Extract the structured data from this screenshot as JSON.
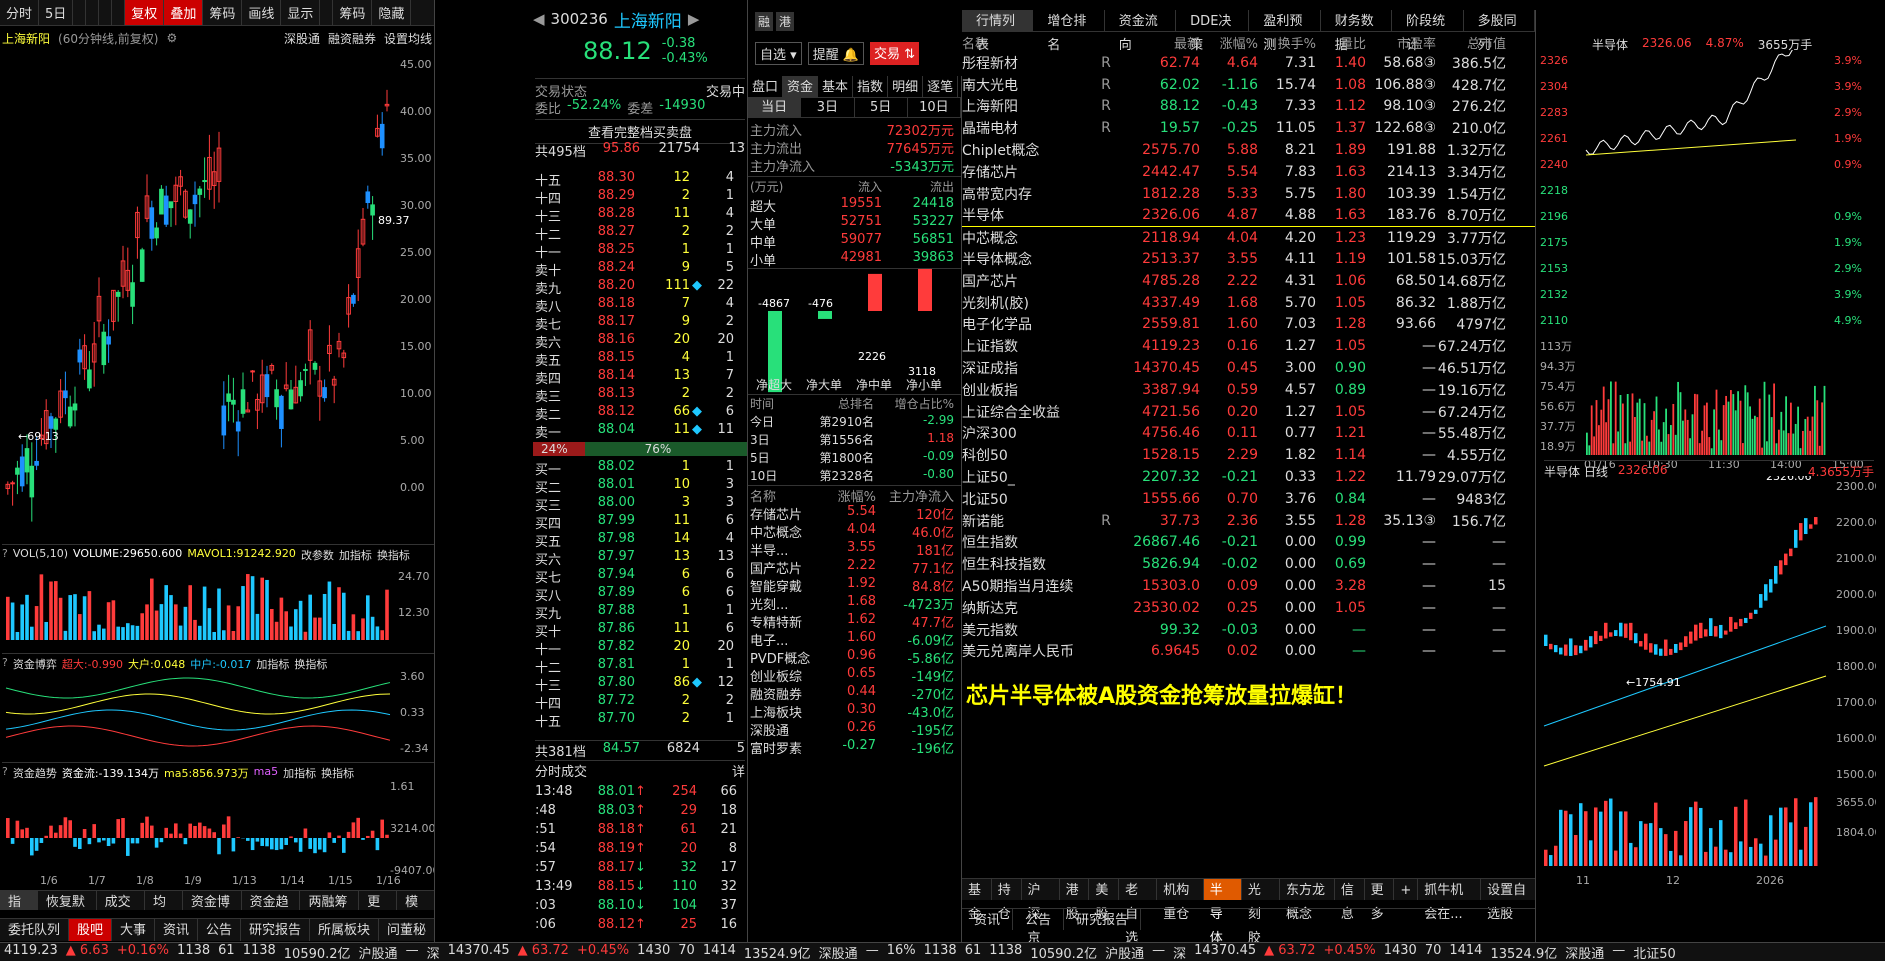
{
  "toolbar": {
    "items": [
      "分时",
      "5日",
      "",
      "",
      "",
      "",
      "复权",
      "叠加",
      "筹码",
      "画线",
      "显示",
      "",
      "筹码",
      "隐藏"
    ]
  },
  "kchart": {
    "title": "上海新阳",
    "subtitle": "(60分钟线,前复权)",
    "links": [
      "深股通",
      "融资融券",
      "设置均线"
    ],
    "yaxis": [
      "45.00",
      "40.00",
      "35.00",
      "30.00",
      "25.00",
      "20.00",
      "15.00",
      "10.00",
      "5.00",
      "0.00"
    ],
    "hi_label": "89.37",
    "lo_label": "69.13",
    "xaxis": [
      "1/6",
      "1/7",
      "1/8",
      "1/9",
      "1/13",
      "1/14",
      "1/15",
      "1/16"
    ],
    "vol": {
      "title": "VOL(5,10)",
      "value": "VOLUME:29650.600",
      "ma": "MAVOL1:91242.920",
      "y": [
        "24.70",
        "12.30"
      ]
    },
    "game": {
      "title": "资金博弈",
      "a": "超大:-0.990",
      "b": "大户:0.048",
      "c": "中户:-0.017",
      "y": [
        "3.60",
        "0.33",
        "-2.34"
      ]
    },
    "trend": {
      "title": "资金趋势",
      "a": "资金流:-139.134万",
      "b": "ma5:856.973万",
      "c": "ma5",
      "y": [
        "1.61",
        "3214.00",
        "-9407.00"
      ]
    },
    "sub_links": [
      "改参数",
      "加指标",
      "换指标"
    ],
    "bottom_tabs": [
      "指标",
      "恢复默认",
      "成交量",
      "均线",
      "资金博弈",
      "资金趋势",
      "两融筹码",
      "更多",
      "模板"
    ]
  },
  "quote": {
    "code": "300236",
    "name": "上海新阳",
    "tags": [
      "融",
      "港"
    ],
    "price": "88.12",
    "chg": "-0.38",
    "pct": "-0.43%",
    "btn1": "自选",
    "btn2": "提醒",
    "btn3": "交易",
    "status_label": "交易状态",
    "status": "交易中",
    "wb_label": "委比",
    "wb": "-52.24%",
    "wc_label": "委差",
    "wc": "-14930",
    "full_label": "查看完整档买卖盘",
    "sell_total": [
      "共495档",
      "95.86",
      "21754",
      "13"
    ],
    "sells": [
      [
        "十五",
        "88.30",
        "12",
        "4",
        ""
      ],
      [
        "十四",
        "88.29",
        "2",
        "1",
        ""
      ],
      [
        "十三",
        "88.28",
        "11",
        "4",
        ""
      ],
      [
        "十二",
        "88.27",
        "2",
        "2",
        ""
      ],
      [
        "十一",
        "88.25",
        "1",
        "1",
        ""
      ],
      [
        "卖十",
        "88.24",
        "9",
        "5",
        ""
      ],
      [
        "卖九",
        "88.20",
        "111",
        "22",
        "◆"
      ],
      [
        "卖八",
        "88.18",
        "7",
        "4",
        ""
      ],
      [
        "卖七",
        "88.17",
        "9",
        "2",
        ""
      ],
      [
        "卖六",
        "88.16",
        "20",
        "20",
        ""
      ],
      [
        "卖五",
        "88.15",
        "4",
        "1",
        ""
      ],
      [
        "卖四",
        "88.14",
        "13",
        "7",
        ""
      ],
      [
        "卖三",
        "88.13",
        "2",
        "2",
        ""
      ],
      [
        "卖二",
        "88.12",
        "66",
        "6",
        "◆"
      ],
      [
        "卖一",
        "88.04",
        "11",
        "11",
        "◆"
      ]
    ],
    "ratio": [
      "24%",
      "76%"
    ],
    "buys": [
      [
        "买一",
        "88.02",
        "1",
        "1",
        ""
      ],
      [
        "买二",
        "88.01",
        "10",
        "3",
        ""
      ],
      [
        "买三",
        "88.00",
        "3",
        "3",
        ""
      ],
      [
        "买四",
        "87.99",
        "11",
        "6",
        ""
      ],
      [
        "买五",
        "87.98",
        "14",
        "4",
        ""
      ],
      [
        "买六",
        "87.97",
        "13",
        "13",
        ""
      ],
      [
        "买七",
        "87.94",
        "6",
        "6",
        ""
      ],
      [
        "买八",
        "87.89",
        "6",
        "6",
        ""
      ],
      [
        "买九",
        "87.88",
        "1",
        "1",
        ""
      ],
      [
        "买十",
        "87.86",
        "11",
        "6",
        ""
      ],
      [
        "十一",
        "87.82",
        "20",
        "20",
        ""
      ],
      [
        "十二",
        "87.81",
        "1",
        "1",
        ""
      ],
      [
        "十三",
        "87.80",
        "86",
        "12",
        "◆"
      ],
      [
        "十四",
        "87.72",
        "2",
        "2",
        ""
      ],
      [
        "十五",
        "87.70",
        "2",
        "1",
        ""
      ]
    ],
    "buy_total": [
      "共381档",
      "84.57",
      "6824",
      "5"
    ],
    "ticks_title": "分时成交",
    "ticks_btn": "详",
    "ticks": [
      [
        "13:48",
        "88.01",
        "↑",
        "254",
        "66"
      ],
      [
        ":48",
        "88.03",
        "↑",
        "29",
        "18"
      ],
      [
        ":51",
        "88.18",
        "↑",
        "61",
        "21"
      ],
      [
        ":54",
        "88.19",
        "↑",
        "20",
        "8"
      ],
      [
        ":57",
        "88.17",
        "↓",
        "32",
        "17"
      ],
      [
        "13:49",
        "88.15",
        "↓",
        "110",
        "32"
      ],
      [
        ":03",
        "88.10",
        "↓",
        "104",
        "37"
      ],
      [
        ":06",
        "88.12",
        "↑",
        "25",
        "16"
      ]
    ]
  },
  "fund": {
    "tabs": [
      "盘口",
      "资金",
      "基本",
      "指数",
      "明细",
      "逐笔"
    ],
    "subtabs": [
      "当日",
      "3日",
      "5日",
      "10日"
    ],
    "main": [
      [
        "主力流入",
        "72302万元"
      ],
      [
        "主力流出",
        "77645万元"
      ],
      [
        "主力净流入",
        "-5343万元"
      ]
    ],
    "unit": "(万元)",
    "col_in": "流入",
    "col_out": "流出",
    "rows": [
      [
        "超大",
        "19551",
        "24418"
      ],
      [
        "大单",
        "52751",
        "53227"
      ],
      [
        "中单",
        "59077",
        "56851"
      ],
      [
        "小单",
        "42981",
        "39863"
      ]
    ],
    "bars": [
      {
        "label": "净超大",
        "v": -4867
      },
      {
        "label": "净大单",
        "v": -476
      },
      {
        "label": "净中单",
        "v": 2226
      },
      {
        "label": "净小单",
        "v": 3118
      }
    ],
    "rank_head": [
      "时间",
      "总排名",
      "增仓占比%"
    ],
    "ranks": [
      [
        "今日",
        "第2910名",
        "-2.99"
      ],
      [
        "3日",
        "第1556名",
        "1.18"
      ],
      [
        "5日",
        "第1800名",
        "-0.09"
      ],
      [
        "10日",
        "第2328名",
        "-0.80"
      ]
    ],
    "sec_head": [
      "名称",
      "涨幅%",
      "主力净流入"
    ],
    "sectors": [
      [
        "存储芯片",
        "5.54",
        "120亿"
      ],
      [
        "中芯概念",
        "4.04",
        "46.0亿"
      ],
      [
        "半导...",
        "3.55",
        "181亿"
      ],
      [
        "国产芯片",
        "2.22",
        "77.1亿"
      ],
      [
        "智能穿戴",
        "1.92",
        "84.8亿"
      ],
      [
        "光刻...",
        "1.68",
        "-4723万"
      ],
      [
        "专精特新",
        "1.62",
        "47.7亿"
      ],
      [
        "电子...",
        "1.60",
        "-6.09亿"
      ],
      [
        "PVDF概念",
        "0.96",
        "-5.86亿"
      ],
      [
        "创业板综",
        "0.65",
        "-149亿"
      ],
      [
        "融资融券",
        "0.44",
        "-270亿"
      ],
      [
        "上海板块",
        "0.30",
        "-43.0亿"
      ],
      [
        "深股通",
        "0.26",
        "-195亿"
      ],
      [
        "富时罗素",
        "-0.27",
        "-196亿"
      ]
    ]
  },
  "list": {
    "tabs": [
      "行情列表",
      "增仓排名",
      "资金流向",
      "DDE决策",
      "盈利预测",
      "财务数据",
      "阶段统计",
      "多股同列"
    ],
    "head": [
      "名称",
      "",
      "最新",
      "涨幅%",
      "换手%",
      "量比",
      "市盈率",
      "总市值"
    ],
    "rows": [
      [
        "彤程新材",
        "R",
        "62.74",
        "4.64",
        "7.31",
        "1.40",
        "58.68③",
        "386.5亿"
      ],
      [
        "南大光电",
        "R",
        "62.02",
        "-1.16",
        "15.74",
        "1.08",
        "106.88③",
        "428.7亿"
      ],
      [
        "上海新阳",
        "R",
        "88.12",
        "-0.43",
        "7.33",
        "1.12",
        "98.10③",
        "276.2亿"
      ],
      [
        "晶瑞电材",
        "R",
        "19.57",
        "-0.25",
        "11.05",
        "1.37",
        "122.68③",
        "210.0亿"
      ],
      [
        "Chiplet概念",
        "",
        "2575.70",
        "5.88",
        "8.21",
        "1.89",
        "191.88",
        "1.32万亿"
      ],
      [
        "存储芯片",
        "",
        "2442.47",
        "5.54",
        "7.83",
        "1.63",
        "214.13",
        "3.34万亿"
      ],
      [
        "高带宽内存",
        "",
        "1812.28",
        "5.33",
        "5.75",
        "1.80",
        "103.39",
        "1.54万亿"
      ],
      [
        "半导体",
        "",
        "2326.06",
        "4.87",
        "4.88",
        "1.63",
        "183.76",
        "8.70万亿"
      ],
      [
        "中芯概念",
        "",
        "2118.94",
        "4.04",
        "4.20",
        "1.23",
        "119.29",
        "3.77万亿"
      ],
      [
        "半导体概念",
        "",
        "2513.37",
        "3.55",
        "4.11",
        "1.19",
        "101.58",
        "15.03万亿"
      ],
      [
        "国产芯片",
        "",
        "4785.28",
        "2.22",
        "4.31",
        "1.06",
        "68.50",
        "14.68万亿"
      ],
      [
        "光刻机(胶)",
        "",
        "4337.49",
        "1.68",
        "5.70",
        "1.05",
        "86.32",
        "1.88万亿"
      ],
      [
        "电子化学品",
        "",
        "2559.81",
        "1.60",
        "7.03",
        "1.28",
        "93.66",
        "4797亿"
      ],
      [
        "上证指数",
        "",
        "4119.23",
        "0.16",
        "1.27",
        "1.05",
        "—",
        "67.24万亿"
      ],
      [
        "深证成指",
        "",
        "14370.45",
        "0.45",
        "3.00",
        "0.90",
        "—",
        "46.51万亿"
      ],
      [
        "创业板指",
        "",
        "3387.94",
        "0.59",
        "4.57",
        "0.89",
        "—",
        "19.16万亿"
      ],
      [
        "上证综合全收益",
        "",
        "4721.56",
        "0.20",
        "1.27",
        "1.05",
        "—",
        "67.24万亿"
      ],
      [
        "沪深300",
        "",
        "4756.46",
        "0.11",
        "0.77",
        "1.21",
        "—",
        "55.48万亿"
      ],
      [
        "科创50",
        "",
        "1528.15",
        "2.29",
        "1.82",
        "1.14",
        "—",
        "4.55万亿"
      ],
      [
        "上证50_",
        "",
        "2207.32",
        "-0.21",
        "0.33",
        "1.22",
        "11.79",
        "29.07万亿"
      ],
      [
        "北证50",
        "",
        "1555.66",
        "0.70",
        "3.76",
        "0.84",
        "—",
        "9483亿"
      ],
      [
        "新诺能",
        "R",
        "37.73",
        "2.36",
        "3.55",
        "1.28",
        "35.13③",
        "156.7亿"
      ],
      [
        "恒生指数",
        "",
        "26867.46",
        "-0.21",
        "0.00",
        "0.99",
        "—",
        "—"
      ],
      [
        "恒生科技指数",
        "",
        "5826.94",
        "-0.02",
        "0.00",
        "0.69",
        "—",
        "—"
      ],
      [
        "A50期指当月连续",
        "",
        "15303.0",
        "0.09",
        "0.00",
        "3.28",
        "—",
        "15"
      ],
      [
        "纳斯达克",
        "",
        "23530.02",
        "0.25",
        "0.00",
        "1.05",
        "—",
        "—"
      ],
      [
        "美元指数",
        "",
        "99.32",
        "-0.03",
        "0.00",
        "—",
        "—",
        "—"
      ],
      [
        "美元兑离岸人民币",
        "",
        "6.9645",
        "0.02",
        "0.00",
        "—",
        "—",
        "—"
      ]
    ],
    "banner": "芯片半导体被A股资金抢筹放量拉爆缸！",
    "bottom_tabs": [
      "基金",
      "持仓",
      "沪深京",
      "港股",
      "美股",
      "老自选",
      "机构重仓",
      "半导体",
      "光刻胶",
      "东方龙概念",
      "信息",
      "更多",
      "+",
      "抓牛机会在...",
      "设置自选股"
    ],
    "news_tabs": [
      "资讯",
      "公告",
      "研究报告"
    ]
  },
  "mini": {
    "name": "半导体",
    "price": "2326.06",
    "pct": "4.87%",
    "vol": "3655万手",
    "yl": [
      "2326",
      "2304",
      "2283",
      "2261",
      "2240",
      "2218",
      "2196",
      "2175",
      "2153",
      "2132",
      "2110"
    ],
    "yr": [
      "3.9%",
      "3.9%",
      "2.9%",
      "1.9%",
      "0.9%",
      "",
      "0.9%",
      "1.9%",
      "2.9%",
      "3.9%",
      "4.9%"
    ],
    "volaxis": [
      "113万",
      "94.3万",
      "75.4万",
      "56.6万",
      "37.7万",
      "18.9万"
    ],
    "times": [
      "01/16",
      "10:30",
      "11:30",
      "14:00",
      "15:00"
    ],
    "day_title": "半导体 日线",
    "day_price": "2326.06",
    "day_extra": "4.3655万手",
    "day_hi": "2326.06",
    "day_lo": "1754.91",
    "day_y": [
      "2300.00",
      "2200.00",
      "2100.00",
      "2000.00",
      "1900.00",
      "1800.00",
      "1700.00",
      "1600.00",
      "1500.00"
    ],
    "day_vol": [
      "3655.00",
      "1804.00"
    ],
    "months": [
      "11",
      "12",
      "2026"
    ]
  },
  "leftbar": [
    "委托队列",
    "股吧",
    "大事",
    "资讯",
    "公告",
    "研究报告",
    "所属板块",
    "问董秘"
  ],
  "status": {
    "items": [
      "4119.23",
      "▲ 6.63",
      "+0.16%",
      "1138",
      "61",
      "1138",
      "10590.2亿",
      "沪股通",
      "—",
      "深",
      "14370.45",
      "▲ 63.72",
      "+0.45%",
      "1430",
      "70",
      "1414",
      "13524.9亿",
      "深股通",
      "—",
      "16%",
      "1138",
      "61",
      "1138",
      "10590.2亿",
      "沪股通",
      "—",
      "深",
      "14370.45",
      "▲ 63.72",
      "+0.45%",
      "1430",
      "70",
      "1414",
      "13524.9亿",
      "深股通",
      "—",
      "北证50"
    ]
  }
}
